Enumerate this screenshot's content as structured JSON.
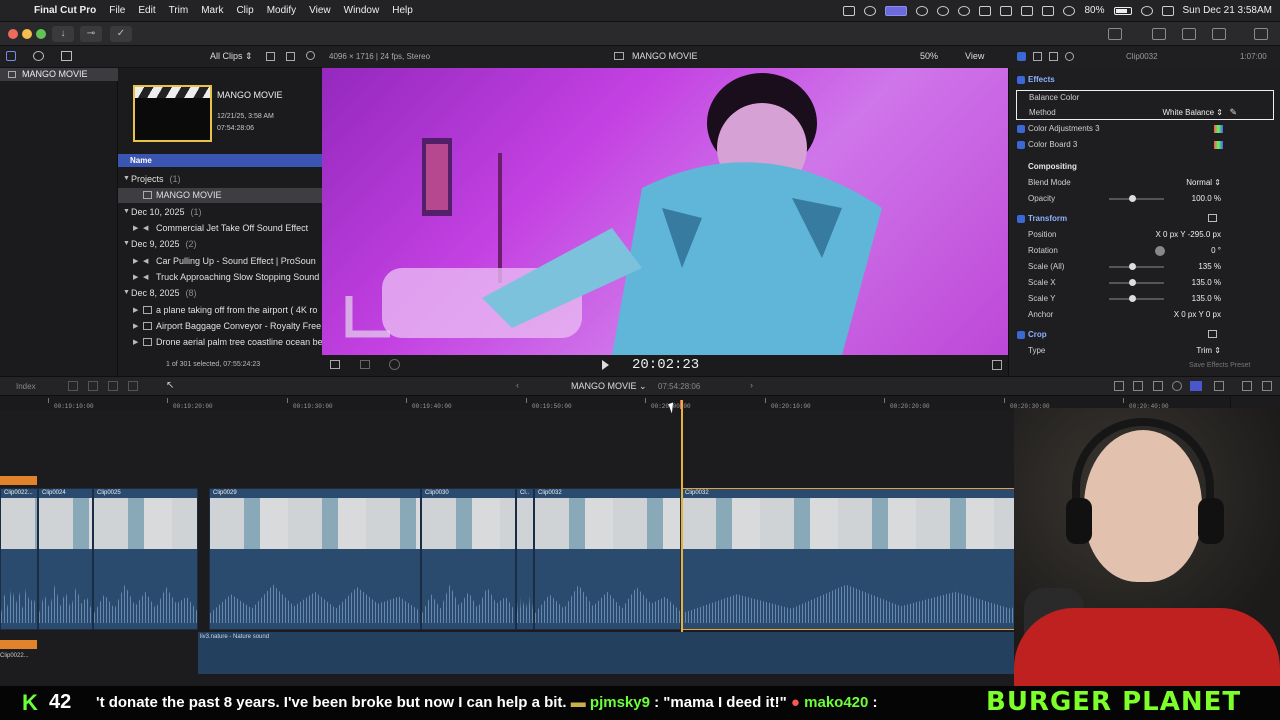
{
  "menubar": {
    "app": "Final Cut Pro",
    "items": [
      "File",
      "Edit",
      "Trim",
      "Mark",
      "Clip",
      "Modify",
      "View",
      "Window",
      "Help"
    ],
    "battery": "80%",
    "datetime": "Sun Dec 21  3:58AM"
  },
  "browser_header": {
    "filter": "All Clips ⇕"
  },
  "viewer_header": {
    "format": "4096 × 1716 | 24 fps, Stereo",
    "project": "MANGO MOVIE",
    "zoom": "50%",
    "view": "View"
  },
  "inspector_header": {
    "clip": "Clip0032",
    "duration": "1:07:00"
  },
  "library": {
    "name": "MANGO MOVIE"
  },
  "browser": {
    "thumb_name": "MANGO MOVIE",
    "thumb_date": "12/21/25, 3:58 AM",
    "thumb_duration": "07:54:28:06",
    "name_column": "Name",
    "groups": [
      {
        "label": "Projects",
        "count": "(1)"
      },
      {
        "label": "Dec 10, 2025",
        "count": "(1)"
      },
      {
        "label": "Dec 9, 2025",
        "count": "(2)"
      },
      {
        "label": "Dec 8, 2025",
        "count": "(8)"
      }
    ],
    "items": [
      "MANGO MOVIE",
      "Commercial Jet Take Off Sound Effect",
      "Car Pulling Up - Sound Effect | ProSoun",
      "Truck Approaching Slow Stopping Sound",
      "a plane taking off from the airport ( 4K ro",
      "Airport Baggage Conveyor - Royalty Free",
      "Drone aerial palm tree coastline ocean be"
    ],
    "status": "1 of 301 selected, 07:55:24:23"
  },
  "viewer": {
    "timecode": "20:02:23"
  },
  "inspector": {
    "effects": "Effects",
    "balance_color": "Balance Color",
    "method_label": "Method",
    "method_value": "White Balance ⇕",
    "color_adjustments": "Color Adjustments 3",
    "color_board": "Color Board 3",
    "compositing": "Compositing",
    "blend_mode_label": "Blend Mode",
    "blend_mode_value": "Normal ⇕",
    "opacity_label": "Opacity",
    "opacity_value": "100.0 %",
    "transform": "Transform",
    "position_label": "Position",
    "position_value": "X      0 px   Y   -295.0 px",
    "rotation_label": "Rotation",
    "rotation_value": "0 °",
    "scale_all_label": "Scale (All)",
    "scale_all_value": "135 %",
    "scale_x_label": "Scale X",
    "scale_x_value": "135.0 %",
    "scale_y_label": "Scale Y",
    "scale_y_value": "135.0 %",
    "anchor_label": "Anchor",
    "anchor_value": "X      0 px   Y      0 px",
    "crop": "Crop",
    "type_label": "Type",
    "type_value": "Trim ⇕",
    "save_preset": "Save Effects Preset"
  },
  "timeline": {
    "index": "Index",
    "project": "MANGO MOVIE ⌄",
    "duration": "07:54:28:06",
    "ruler": [
      "00:19:10:00",
      "00:19:20:00",
      "00:19:30:00",
      "00:19:40:00",
      "00:19:50:00",
      "00:20:00:00",
      "00:20:10:00",
      "00:20:20:00",
      "00:20:30:00",
      "00:20:40:00"
    ],
    "clips": [
      "Clip0022...",
      "Clip0024",
      "Clip0025",
      "Clip0029",
      "Clip0030",
      "Cl..",
      "Clip0032",
      "Clip0032"
    ],
    "audio": "liv3.nature - Nature sound",
    "lower_stub": "Clip0022..."
  },
  "ticker": {
    "count_icon": "K",
    "count": "42",
    "message": "'t donate the past 8 years. I've been broke but now I can help a bit.",
    "user1": "pjmsky9",
    "msg1": ": \"mama I deed it!\"",
    "user2": "mako420",
    "msg2": ":",
    "brand": "BURGER PLANET"
  }
}
